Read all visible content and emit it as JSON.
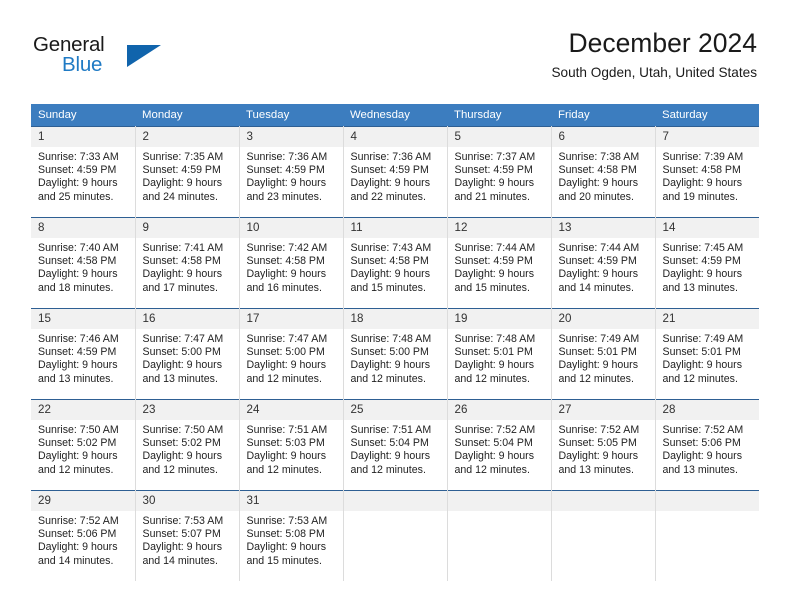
{
  "brand": {
    "line1": "General",
    "line2": "Blue",
    "triangle_icon": "blue-triangle-icon",
    "colors": {
      "general_text": "#1a1a1a",
      "blue_text": "#1f7ac4",
      "triangle": "#1064ac"
    }
  },
  "header": {
    "title": "December 2024",
    "subtitle": "South Ogden, Utah, United States"
  },
  "theme": {
    "header_row_bg": "#3c7dbf",
    "header_row_text": "#ffffff",
    "daynum_bg": "#f1f1f1",
    "row_divider": "#2e5f93",
    "cell_divider": "#dcdcdc"
  },
  "weekdays": [
    "Sunday",
    "Monday",
    "Tuesday",
    "Wednesday",
    "Thursday",
    "Friday",
    "Saturday"
  ],
  "labels": {
    "sunrise_prefix": "Sunrise:",
    "sunset_prefix": "Sunset:",
    "daylight_prefix": "Daylight:"
  },
  "weeks": [
    [
      {
        "day": "1",
        "sunrise": "Sunrise: 7:33 AM",
        "sunset": "Sunset: 4:59 PM",
        "daylight1": "Daylight: 9 hours",
        "daylight2": "and 25 minutes."
      },
      {
        "day": "2",
        "sunrise": "Sunrise: 7:35 AM",
        "sunset": "Sunset: 4:59 PM",
        "daylight1": "Daylight: 9 hours",
        "daylight2": "and 24 minutes."
      },
      {
        "day": "3",
        "sunrise": "Sunrise: 7:36 AM",
        "sunset": "Sunset: 4:59 PM",
        "daylight1": "Daylight: 9 hours",
        "daylight2": "and 23 minutes."
      },
      {
        "day": "4",
        "sunrise": "Sunrise: 7:36 AM",
        "sunset": "Sunset: 4:59 PM",
        "daylight1": "Daylight: 9 hours",
        "daylight2": "and 22 minutes."
      },
      {
        "day": "5",
        "sunrise": "Sunrise: 7:37 AM",
        "sunset": "Sunset: 4:59 PM",
        "daylight1": "Daylight: 9 hours",
        "daylight2": "and 21 minutes."
      },
      {
        "day": "6",
        "sunrise": "Sunrise: 7:38 AM",
        "sunset": "Sunset: 4:58 PM",
        "daylight1": "Daylight: 9 hours",
        "daylight2": "and 20 minutes."
      },
      {
        "day": "7",
        "sunrise": "Sunrise: 7:39 AM",
        "sunset": "Sunset: 4:58 PM",
        "daylight1": "Daylight: 9 hours",
        "daylight2": "and 19 minutes."
      }
    ],
    [
      {
        "day": "8",
        "sunrise": "Sunrise: 7:40 AM",
        "sunset": "Sunset: 4:58 PM",
        "daylight1": "Daylight: 9 hours",
        "daylight2": "and 18 minutes."
      },
      {
        "day": "9",
        "sunrise": "Sunrise: 7:41 AM",
        "sunset": "Sunset: 4:58 PM",
        "daylight1": "Daylight: 9 hours",
        "daylight2": "and 17 minutes."
      },
      {
        "day": "10",
        "sunrise": "Sunrise: 7:42 AM",
        "sunset": "Sunset: 4:58 PM",
        "daylight1": "Daylight: 9 hours",
        "daylight2": "and 16 minutes."
      },
      {
        "day": "11",
        "sunrise": "Sunrise: 7:43 AM",
        "sunset": "Sunset: 4:58 PM",
        "daylight1": "Daylight: 9 hours",
        "daylight2": "and 15 minutes."
      },
      {
        "day": "12",
        "sunrise": "Sunrise: 7:44 AM",
        "sunset": "Sunset: 4:59 PM",
        "daylight1": "Daylight: 9 hours",
        "daylight2": "and 15 minutes."
      },
      {
        "day": "13",
        "sunrise": "Sunrise: 7:44 AM",
        "sunset": "Sunset: 4:59 PM",
        "daylight1": "Daylight: 9 hours",
        "daylight2": "and 14 minutes."
      },
      {
        "day": "14",
        "sunrise": "Sunrise: 7:45 AM",
        "sunset": "Sunset: 4:59 PM",
        "daylight1": "Daylight: 9 hours",
        "daylight2": "and 13 minutes."
      }
    ],
    [
      {
        "day": "15",
        "sunrise": "Sunrise: 7:46 AM",
        "sunset": "Sunset: 4:59 PM",
        "daylight1": "Daylight: 9 hours",
        "daylight2": "and 13 minutes."
      },
      {
        "day": "16",
        "sunrise": "Sunrise: 7:47 AM",
        "sunset": "Sunset: 5:00 PM",
        "daylight1": "Daylight: 9 hours",
        "daylight2": "and 13 minutes."
      },
      {
        "day": "17",
        "sunrise": "Sunrise: 7:47 AM",
        "sunset": "Sunset: 5:00 PM",
        "daylight1": "Daylight: 9 hours",
        "daylight2": "and 12 minutes."
      },
      {
        "day": "18",
        "sunrise": "Sunrise: 7:48 AM",
        "sunset": "Sunset: 5:00 PM",
        "daylight1": "Daylight: 9 hours",
        "daylight2": "and 12 minutes."
      },
      {
        "day": "19",
        "sunrise": "Sunrise: 7:48 AM",
        "sunset": "Sunset: 5:01 PM",
        "daylight1": "Daylight: 9 hours",
        "daylight2": "and 12 minutes."
      },
      {
        "day": "20",
        "sunrise": "Sunrise: 7:49 AM",
        "sunset": "Sunset: 5:01 PM",
        "daylight1": "Daylight: 9 hours",
        "daylight2": "and 12 minutes."
      },
      {
        "day": "21",
        "sunrise": "Sunrise: 7:49 AM",
        "sunset": "Sunset: 5:01 PM",
        "daylight1": "Daylight: 9 hours",
        "daylight2": "and 12 minutes."
      }
    ],
    [
      {
        "day": "22",
        "sunrise": "Sunrise: 7:50 AM",
        "sunset": "Sunset: 5:02 PM",
        "daylight1": "Daylight: 9 hours",
        "daylight2": "and 12 minutes."
      },
      {
        "day": "23",
        "sunrise": "Sunrise: 7:50 AM",
        "sunset": "Sunset: 5:02 PM",
        "daylight1": "Daylight: 9 hours",
        "daylight2": "and 12 minutes."
      },
      {
        "day": "24",
        "sunrise": "Sunrise: 7:51 AM",
        "sunset": "Sunset: 5:03 PM",
        "daylight1": "Daylight: 9 hours",
        "daylight2": "and 12 minutes."
      },
      {
        "day": "25",
        "sunrise": "Sunrise: 7:51 AM",
        "sunset": "Sunset: 5:04 PM",
        "daylight1": "Daylight: 9 hours",
        "daylight2": "and 12 minutes."
      },
      {
        "day": "26",
        "sunrise": "Sunrise: 7:52 AM",
        "sunset": "Sunset: 5:04 PM",
        "daylight1": "Daylight: 9 hours",
        "daylight2": "and 12 minutes."
      },
      {
        "day": "27",
        "sunrise": "Sunrise: 7:52 AM",
        "sunset": "Sunset: 5:05 PM",
        "daylight1": "Daylight: 9 hours",
        "daylight2": "and 13 minutes."
      },
      {
        "day": "28",
        "sunrise": "Sunrise: 7:52 AM",
        "sunset": "Sunset: 5:06 PM",
        "daylight1": "Daylight: 9 hours",
        "daylight2": "and 13 minutes."
      }
    ],
    [
      {
        "day": "29",
        "sunrise": "Sunrise: 7:52 AM",
        "sunset": "Sunset: 5:06 PM",
        "daylight1": "Daylight: 9 hours",
        "daylight2": "and 14 minutes."
      },
      {
        "day": "30",
        "sunrise": "Sunrise: 7:53 AM",
        "sunset": "Sunset: 5:07 PM",
        "daylight1": "Daylight: 9 hours",
        "daylight2": "and 14 minutes."
      },
      {
        "day": "31",
        "sunrise": "Sunrise: 7:53 AM",
        "sunset": "Sunset: 5:08 PM",
        "daylight1": "Daylight: 9 hours",
        "daylight2": "and 15 minutes."
      },
      {
        "day": "",
        "sunrise": "",
        "sunset": "",
        "daylight1": "",
        "daylight2": ""
      },
      {
        "day": "",
        "sunrise": "",
        "sunset": "",
        "daylight1": "",
        "daylight2": ""
      },
      {
        "day": "",
        "sunrise": "",
        "sunset": "",
        "daylight1": "",
        "daylight2": ""
      },
      {
        "day": "",
        "sunrise": "",
        "sunset": "",
        "daylight1": "",
        "daylight2": ""
      }
    ]
  ]
}
